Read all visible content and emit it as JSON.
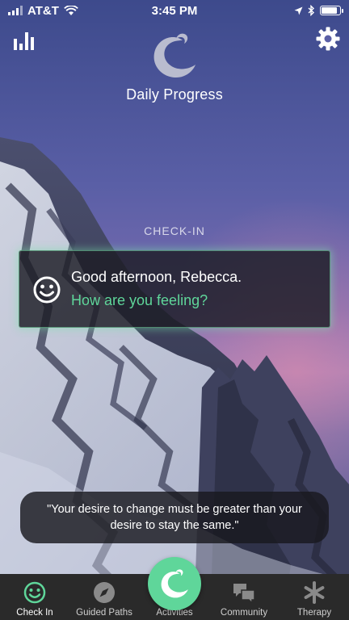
{
  "status_bar": {
    "carrier": "AT&T",
    "time": "3:45 PM",
    "battery_level": 0.85
  },
  "header": {
    "title": "Daily Progress",
    "left_icon": "bar-chart-icon",
    "right_icon": "gear-icon",
    "logo_icon": "app-logo-icon"
  },
  "checkin": {
    "section_label": "CHECK-IN",
    "greeting": "Good afternoon, Rebecca.",
    "prompt": "How are you feeling?",
    "icon": "smiley-face-icon"
  },
  "quote": {
    "text": "\"Your desire to change must be greater than your desire to stay the same.\""
  },
  "tab_bar": {
    "tabs": [
      {
        "label": "Check In",
        "icon": "smiley-face-icon",
        "active": true
      },
      {
        "label": "Guided Paths",
        "icon": "compass-icon",
        "active": false
      },
      {
        "label": "Activities",
        "icon": "app-logo-icon",
        "active": false
      },
      {
        "label": "Community",
        "icon": "chat-bubbles-icon",
        "active": false
      },
      {
        "label": "Therapy",
        "icon": "asterisk-icon",
        "active": false
      }
    ]
  },
  "colors": {
    "accent": "#5fd69a",
    "tab_bar_bg": "#2a2a2a",
    "card_bg": "#1c1c24"
  }
}
